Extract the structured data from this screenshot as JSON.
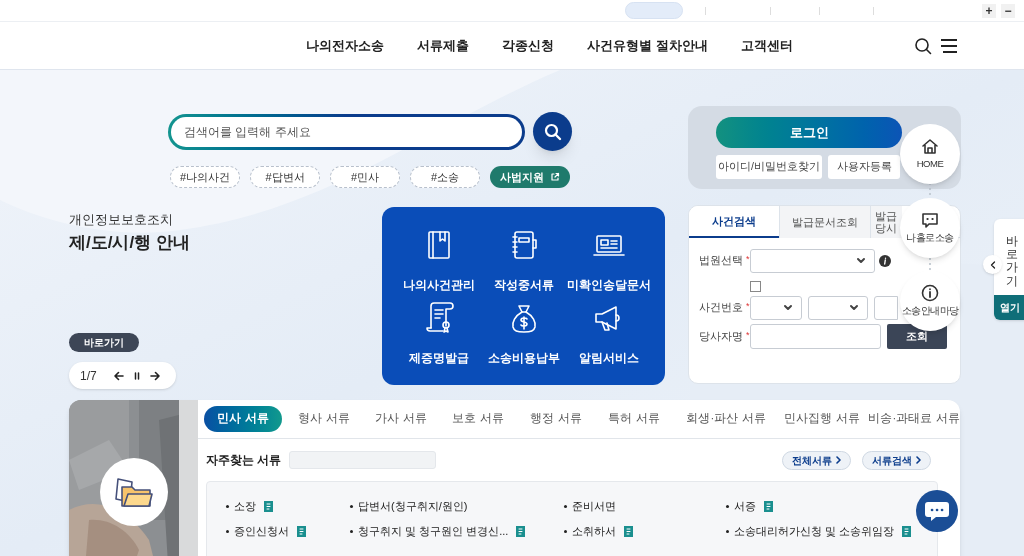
{
  "top_bar": {
    "zoom_in": "+",
    "zoom_out": "−"
  },
  "nav": {
    "items": [
      "나의전자소송",
      "서류제출",
      "각종신청",
      "사건유형별 절차안내",
      "고객센터"
    ]
  },
  "search": {
    "placeholder": "검색어를 입력해 주세요"
  },
  "tags": [
    {
      "label": "#나의사건",
      "kind": "hashtag"
    },
    {
      "label": "#답변서",
      "kind": "hashtag"
    },
    {
      "label": "#민사",
      "kind": "hashtag"
    },
    {
      "label": "#소송",
      "kind": "hashtag"
    },
    {
      "label": "사법지원",
      "kind": "link"
    }
  ],
  "notice": {
    "subtitle": "개인정보보호조치",
    "title": "제/도/시/행 안내",
    "button": "바로가기"
  },
  "pager": {
    "counter": "1/7"
  },
  "quick_menu": [
    {
      "label": "나의사건관리",
      "kind": "book"
    },
    {
      "label": "작성중서류",
      "kind": "notebook"
    },
    {
      "label": "미확인송달문서",
      "kind": "laptop"
    },
    {
      "label": "제증명발급",
      "kind": "certificate"
    },
    {
      "label": "소송비용납부",
      "kind": "money"
    },
    {
      "label": "알림서비스",
      "kind": "megaphone"
    }
  ],
  "login": {
    "button": "로그인",
    "links": [
      "아이디/비밀번호찾기",
      "사용자등록"
    ]
  },
  "case_search": {
    "tabs": [
      {
        "label": "사건검색",
        "selected": true
      },
      {
        "label": "발급문서조회",
        "selected": false
      },
      {
        "label": "발급 당시",
        "selected": false
      }
    ],
    "court_label": "법원선택",
    "case_number_label": "사건번호",
    "party_label": "당사자명",
    "required_mark": "*",
    "checked": false,
    "submit": "조회"
  },
  "quick_links": [
    {
      "label": "HOME",
      "kind": "home"
    },
    {
      "label": "나홀로소송",
      "kind": "chat"
    },
    {
      "label": "소송안내마당",
      "kind": "info"
    }
  ],
  "side_panel": {
    "title": "바로가기",
    "button": "열기"
  },
  "documents": {
    "tabs": [
      {
        "label": "민사 서류",
        "selected": true
      },
      {
        "label": "형사 서류",
        "selected": false
      },
      {
        "label": "가사 서류",
        "selected": false
      },
      {
        "label": "보호 서류",
        "selected": false
      },
      {
        "label": "행정 서류",
        "selected": false
      },
      {
        "label": "특허 서류",
        "selected": false
      },
      {
        "label": "회생·파산 서류",
        "selected": false
      },
      {
        "label": "민사집행 서류",
        "selected": false
      },
      {
        "label": "비송·과태료 서류",
        "selected": false
      }
    ],
    "frequent_label": "자주찾는 서류",
    "buttons": [
      "전체서류",
      "서류검색"
    ],
    "items": [
      {
        "label": "소장",
        "file": true
      },
      {
        "label": "답변서(청구취지/원인)",
        "file": false
      },
      {
        "label": "준비서면",
        "file": false
      },
      {
        "label": "서증",
        "file": true
      },
      {
        "label": "증인신청서",
        "file": true
      },
      {
        "label": "청구취지 및 청구원인 변경신...",
        "file": true
      },
      {
        "label": "소취하서",
        "file": true
      },
      {
        "label": "소송대리허가신청 및 소송위임장",
        "file": true
      }
    ]
  }
}
